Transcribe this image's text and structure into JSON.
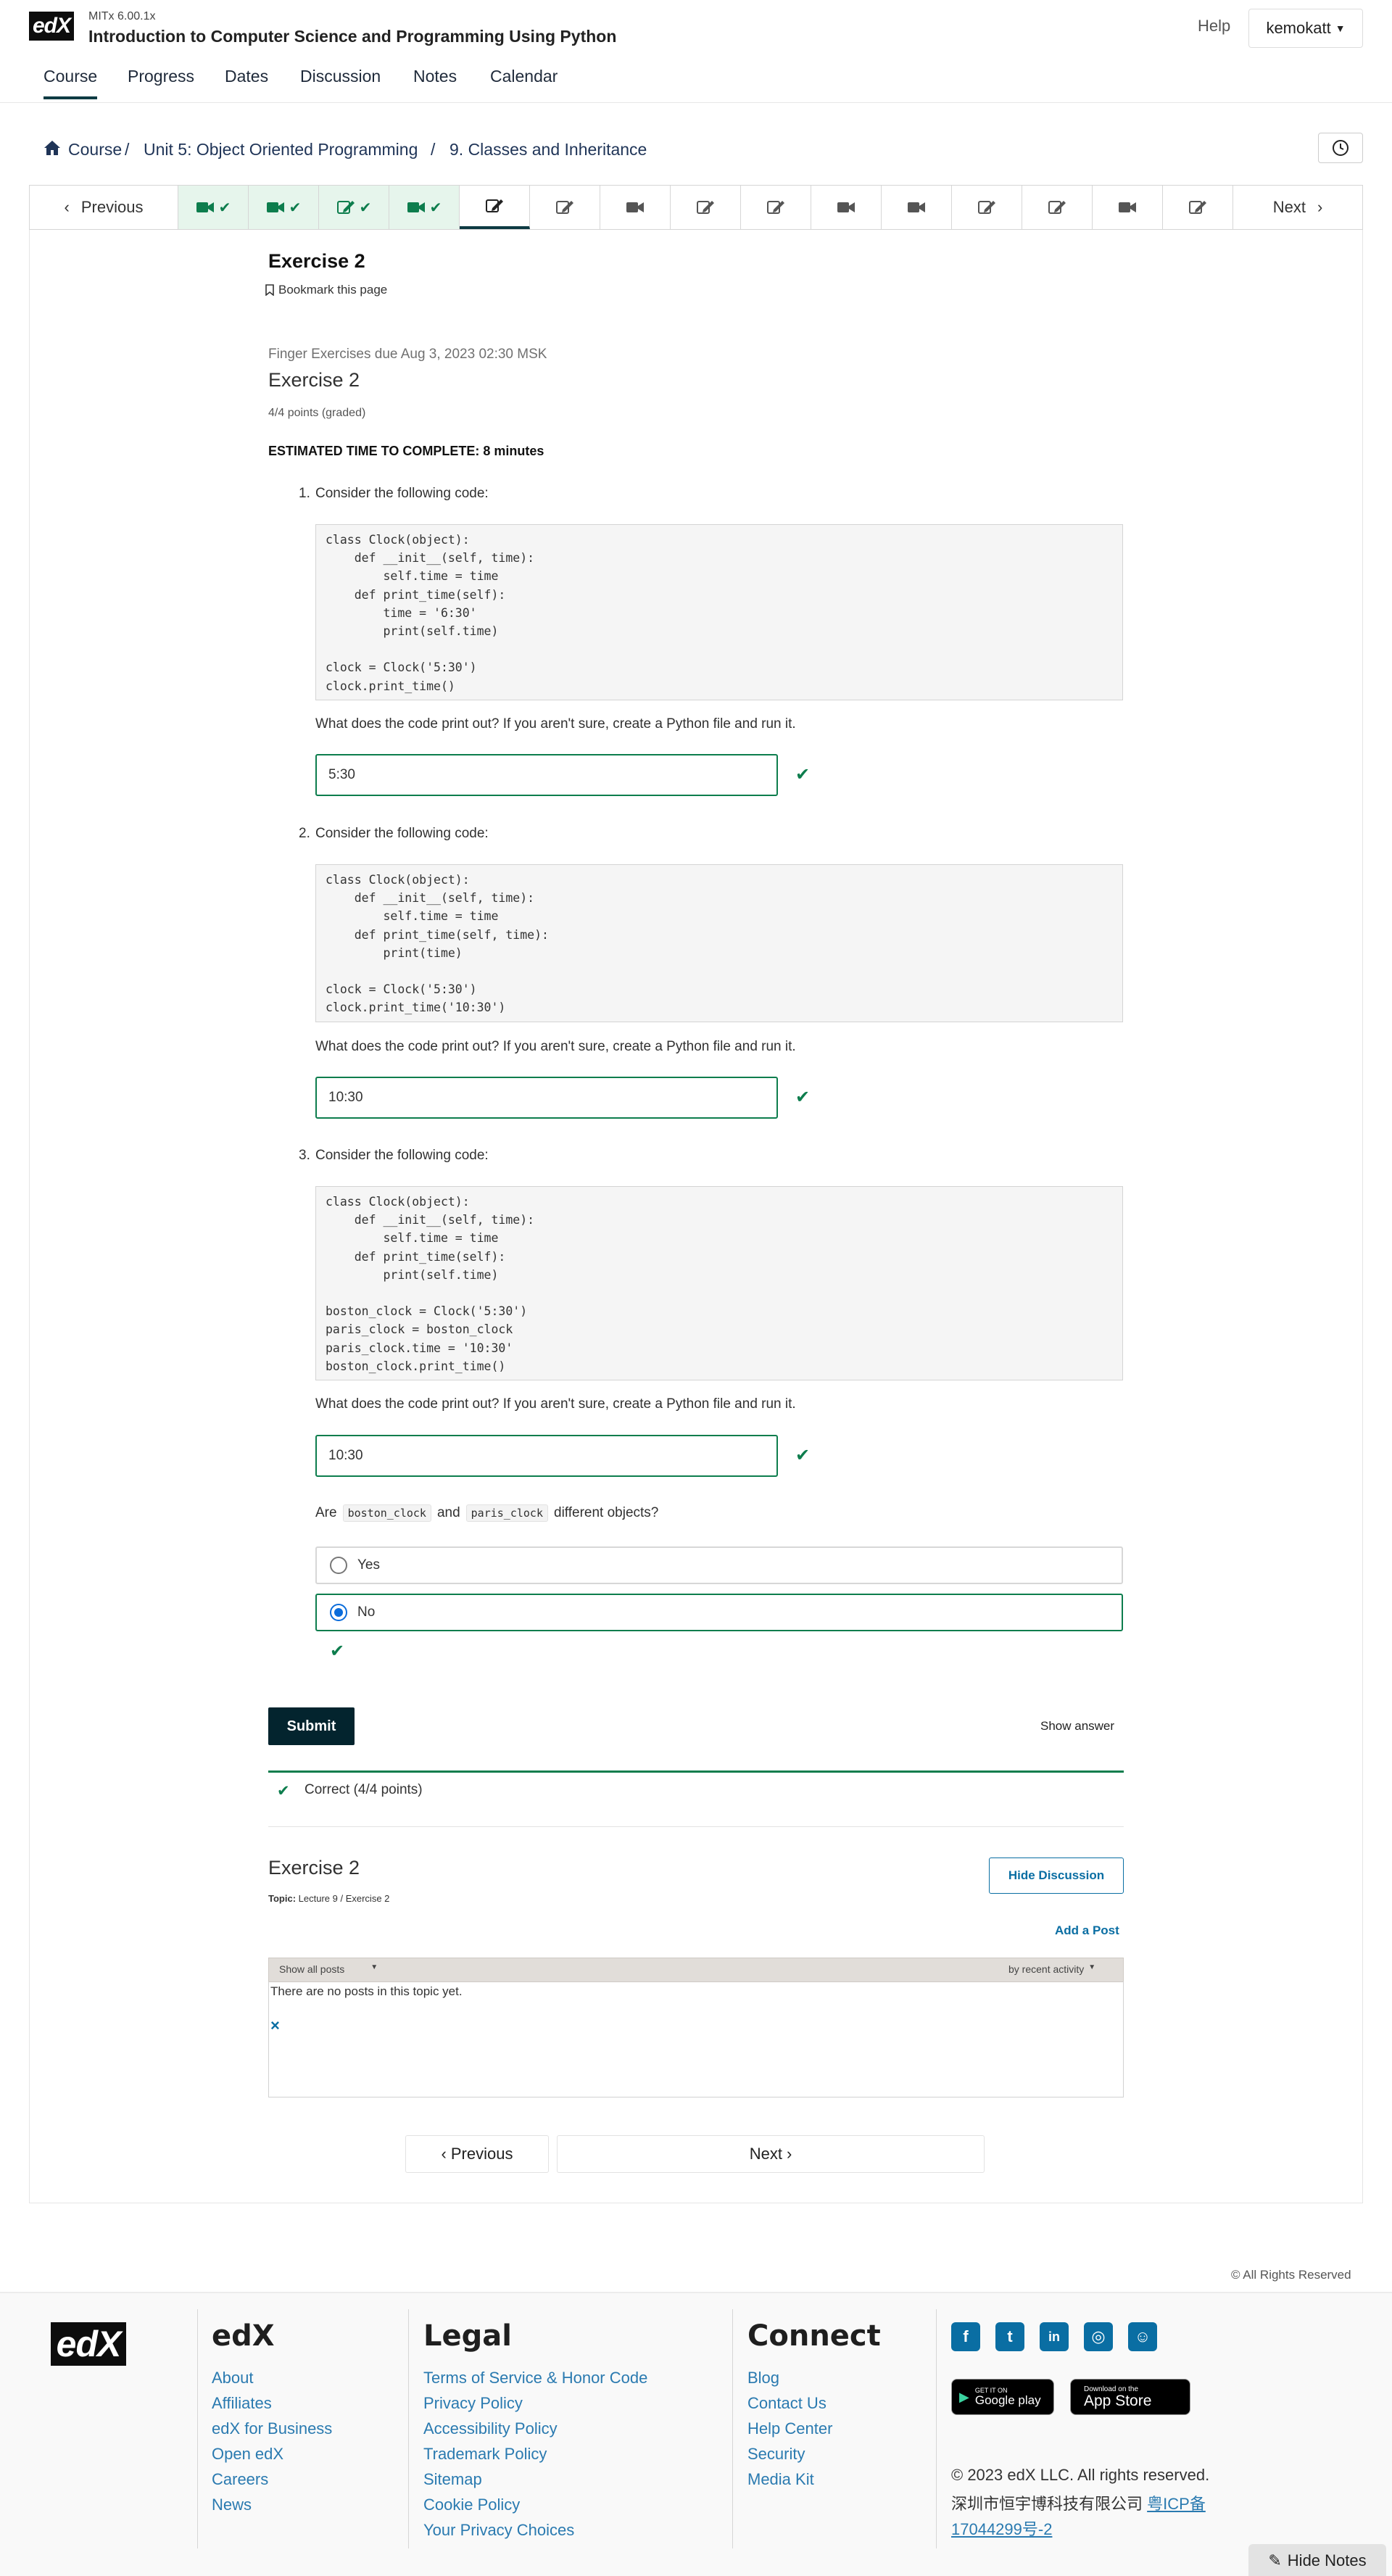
{
  "header": {
    "logo": "edX",
    "course_code": "MITx 6.00.1x",
    "course_title": "Introduction to Computer Science and Programming Using Python",
    "help": "Help",
    "user": "kemokatt",
    "tabs": [
      "Course",
      "Progress",
      "Dates",
      "Discussion",
      "Notes",
      "Calendar"
    ]
  },
  "breadcrumb": {
    "items": [
      "Course",
      "Unit 5: Object Oriented Programming",
      "9. Classes and Inheritance"
    ],
    "separator": "/"
  },
  "unit_nav": {
    "previous": "Previous",
    "next": "Next",
    "items": [
      {
        "icon": "video-icon",
        "done": true
      },
      {
        "icon": "video-icon",
        "done": true
      },
      {
        "icon": "edit-icon",
        "done": true
      },
      {
        "icon": "video-icon",
        "done": true
      },
      {
        "icon": "edit-icon",
        "active": true
      },
      {
        "icon": "edit-icon"
      },
      {
        "icon": "video-icon"
      },
      {
        "icon": "edit-icon"
      },
      {
        "icon": "edit-icon"
      },
      {
        "icon": "video-icon"
      },
      {
        "icon": "video-icon"
      },
      {
        "icon": "edit-icon"
      },
      {
        "icon": "edit-icon"
      },
      {
        "icon": "video-icon"
      },
      {
        "icon": "edit-icon"
      }
    ]
  },
  "unit": {
    "title": "Exercise 2",
    "bookmark": "Bookmark this page"
  },
  "problem": {
    "due": "Finger Exercises due Aug 3, 2023 02:30 MSK",
    "title": "Exercise 2",
    "points": "4/4 points (graded)",
    "estimated": "ESTIMATED TIME TO COMPLETE: 8 minutes",
    "questions": [
      {
        "num": "1.",
        "prompt": "Consider the following code:",
        "code": "class Clock(object):\n    def __init__(self, time):\n        self.time = time\n    def print_time(self):\n        time = '6:30'\n        print(self.time)\n\nclock = Clock('5:30')\nclock.print_time()",
        "ask": "What does the code print out? If you aren't sure, create a Python file and run it.",
        "answer": "5:30"
      },
      {
        "num": "2.",
        "prompt": "Consider the following code:",
        "code": "class Clock(object):\n    def __init__(self, time):\n        self.time = time\n    def print_time(self, time):\n        print(time)\n\nclock = Clock('5:30')\nclock.print_time('10:30')",
        "ask": "What does the code print out? If you aren't sure, create a Python file and run it.",
        "answer": "10:30"
      },
      {
        "num": "3.",
        "prompt": "Consider the following code:",
        "code": "class Clock(object):\n    def __init__(self, time):\n        self.time = time\n    def print_time(self):\n        print(self.time)\n\nboston_clock = Clock('5:30')\nparis_clock = boston_clock\nparis_clock.time = '10:30'\nboston_clock.print_time()",
        "ask": "What does the code print out? If you aren't sure, create a Python file and run it.",
        "answer": "10:30"
      }
    ],
    "q4": {
      "pre": "Are",
      "code1": "boston_clock",
      "mid": "and",
      "code2": "paris_clock",
      "post": "different objects?",
      "options": [
        "Yes",
        "No"
      ],
      "selected": "No"
    },
    "submit": "Submit",
    "show_answer": "Show answer",
    "result": "Correct (4/4 points)"
  },
  "discussion": {
    "title": "Exercise 2",
    "topic_label": "Topic:",
    "topic": "Lecture 9 / Exercise 2",
    "hide": "Hide Discussion",
    "add_post": "Add a Post",
    "filter": "Show all posts",
    "sort": "by recent activity",
    "empty": "There are no posts in this topic yet.",
    "close": "×"
  },
  "bottom_nav": {
    "previous": "Previous",
    "next": "Next"
  },
  "rights": "© All Rights Reserved",
  "footer": {
    "brand": "edX",
    "edx_links": [
      "About",
      "Affiliates",
      "edX for Business",
      "Open edX",
      "Careers",
      "News"
    ],
    "legal_title": "Legal",
    "legal_links": [
      "Terms of Service & Honor Code",
      "Privacy Policy",
      "Accessibility Policy",
      "Trademark Policy",
      "Sitemap",
      "Cookie Policy",
      "Your Privacy Choices"
    ],
    "connect_title": "Connect",
    "connect_links": [
      "Blog",
      "Contact Us",
      "Help Center",
      "Security",
      "Media Kit"
    ],
    "social": [
      "facebook-icon",
      "twitter-icon",
      "linkedin-icon",
      "instagram-icon",
      "reddit-icon"
    ],
    "google_play_small": "GET IT ON",
    "google_play": "Google play",
    "app_store_small": "Download on the",
    "app_store": "App Store",
    "copyright": "© 2023 edX LLC. All rights reserved.",
    "icp_text": "深圳市恒宇博科技有限公司",
    "icp_link_1": "粤ICP备",
    "icp_link_2": "17044299号-2",
    "hide_notes": "Hide Notes"
  },
  "colors": {
    "accent": "#0e3b43",
    "success": "#0d7d4d",
    "link": "#0a3055"
  }
}
